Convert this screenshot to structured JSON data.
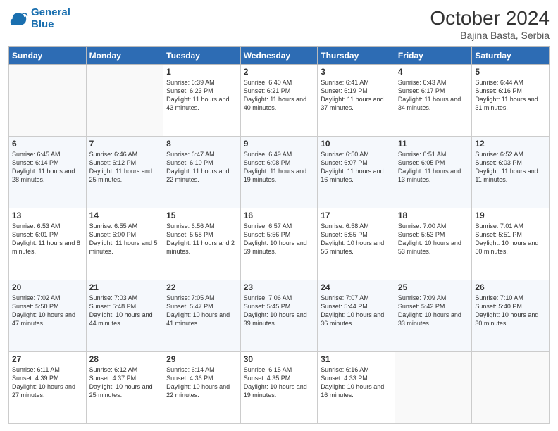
{
  "header": {
    "logo_line1": "General",
    "logo_line2": "Blue",
    "month": "October 2024",
    "location": "Bajina Basta, Serbia"
  },
  "days_of_week": [
    "Sunday",
    "Monday",
    "Tuesday",
    "Wednesday",
    "Thursday",
    "Friday",
    "Saturday"
  ],
  "weeks": [
    [
      {
        "day": "",
        "info": ""
      },
      {
        "day": "",
        "info": ""
      },
      {
        "day": "1",
        "info": "Sunrise: 6:39 AM\nSunset: 6:23 PM\nDaylight: 11 hours and 43 minutes."
      },
      {
        "day": "2",
        "info": "Sunrise: 6:40 AM\nSunset: 6:21 PM\nDaylight: 11 hours and 40 minutes."
      },
      {
        "day": "3",
        "info": "Sunrise: 6:41 AM\nSunset: 6:19 PM\nDaylight: 11 hours and 37 minutes."
      },
      {
        "day": "4",
        "info": "Sunrise: 6:43 AM\nSunset: 6:17 PM\nDaylight: 11 hours and 34 minutes."
      },
      {
        "day": "5",
        "info": "Sunrise: 6:44 AM\nSunset: 6:16 PM\nDaylight: 11 hours and 31 minutes."
      }
    ],
    [
      {
        "day": "6",
        "info": "Sunrise: 6:45 AM\nSunset: 6:14 PM\nDaylight: 11 hours and 28 minutes."
      },
      {
        "day": "7",
        "info": "Sunrise: 6:46 AM\nSunset: 6:12 PM\nDaylight: 11 hours and 25 minutes."
      },
      {
        "day": "8",
        "info": "Sunrise: 6:47 AM\nSunset: 6:10 PM\nDaylight: 11 hours and 22 minutes."
      },
      {
        "day": "9",
        "info": "Sunrise: 6:49 AM\nSunset: 6:08 PM\nDaylight: 11 hours and 19 minutes."
      },
      {
        "day": "10",
        "info": "Sunrise: 6:50 AM\nSunset: 6:07 PM\nDaylight: 11 hours and 16 minutes."
      },
      {
        "day": "11",
        "info": "Sunrise: 6:51 AM\nSunset: 6:05 PM\nDaylight: 11 hours and 13 minutes."
      },
      {
        "day": "12",
        "info": "Sunrise: 6:52 AM\nSunset: 6:03 PM\nDaylight: 11 hours and 11 minutes."
      }
    ],
    [
      {
        "day": "13",
        "info": "Sunrise: 6:53 AM\nSunset: 6:01 PM\nDaylight: 11 hours and 8 minutes."
      },
      {
        "day": "14",
        "info": "Sunrise: 6:55 AM\nSunset: 6:00 PM\nDaylight: 11 hours and 5 minutes."
      },
      {
        "day": "15",
        "info": "Sunrise: 6:56 AM\nSunset: 5:58 PM\nDaylight: 11 hours and 2 minutes."
      },
      {
        "day": "16",
        "info": "Sunrise: 6:57 AM\nSunset: 5:56 PM\nDaylight: 10 hours and 59 minutes."
      },
      {
        "day": "17",
        "info": "Sunrise: 6:58 AM\nSunset: 5:55 PM\nDaylight: 10 hours and 56 minutes."
      },
      {
        "day": "18",
        "info": "Sunrise: 7:00 AM\nSunset: 5:53 PM\nDaylight: 10 hours and 53 minutes."
      },
      {
        "day": "19",
        "info": "Sunrise: 7:01 AM\nSunset: 5:51 PM\nDaylight: 10 hours and 50 minutes."
      }
    ],
    [
      {
        "day": "20",
        "info": "Sunrise: 7:02 AM\nSunset: 5:50 PM\nDaylight: 10 hours and 47 minutes."
      },
      {
        "day": "21",
        "info": "Sunrise: 7:03 AM\nSunset: 5:48 PM\nDaylight: 10 hours and 44 minutes."
      },
      {
        "day": "22",
        "info": "Sunrise: 7:05 AM\nSunset: 5:47 PM\nDaylight: 10 hours and 41 minutes."
      },
      {
        "day": "23",
        "info": "Sunrise: 7:06 AM\nSunset: 5:45 PM\nDaylight: 10 hours and 39 minutes."
      },
      {
        "day": "24",
        "info": "Sunrise: 7:07 AM\nSunset: 5:44 PM\nDaylight: 10 hours and 36 minutes."
      },
      {
        "day": "25",
        "info": "Sunrise: 7:09 AM\nSunset: 5:42 PM\nDaylight: 10 hours and 33 minutes."
      },
      {
        "day": "26",
        "info": "Sunrise: 7:10 AM\nSunset: 5:40 PM\nDaylight: 10 hours and 30 minutes."
      }
    ],
    [
      {
        "day": "27",
        "info": "Sunrise: 6:11 AM\nSunset: 4:39 PM\nDaylight: 10 hours and 27 minutes."
      },
      {
        "day": "28",
        "info": "Sunrise: 6:12 AM\nSunset: 4:37 PM\nDaylight: 10 hours and 25 minutes."
      },
      {
        "day": "29",
        "info": "Sunrise: 6:14 AM\nSunset: 4:36 PM\nDaylight: 10 hours and 22 minutes."
      },
      {
        "day": "30",
        "info": "Sunrise: 6:15 AM\nSunset: 4:35 PM\nDaylight: 10 hours and 19 minutes."
      },
      {
        "day": "31",
        "info": "Sunrise: 6:16 AM\nSunset: 4:33 PM\nDaylight: 10 hours and 16 minutes."
      },
      {
        "day": "",
        "info": ""
      },
      {
        "day": "",
        "info": ""
      }
    ]
  ]
}
